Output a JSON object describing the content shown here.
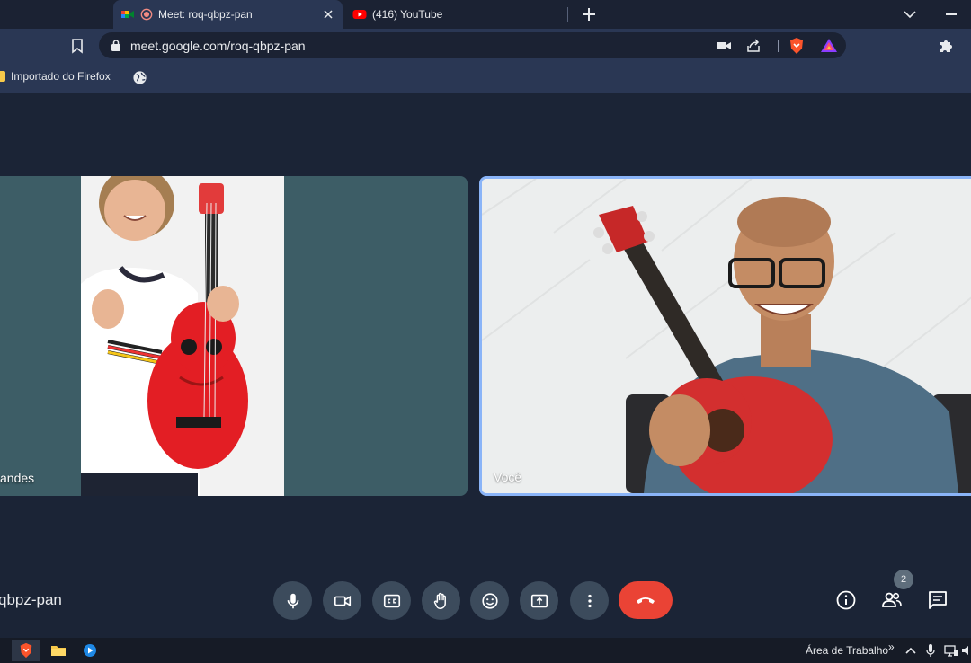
{
  "browser": {
    "tabs": [
      {
        "title": "Meet: roq-qbpz-pan",
        "active": true
      },
      {
        "title": "(416) YouTube",
        "active": false
      }
    ],
    "url": "meet.google.com/roq-qbpz-pan",
    "bookmarks": [
      {
        "label": "Importado do Firefox"
      }
    ]
  },
  "meet": {
    "participants": [
      {
        "name": "andes",
        "speaking": false
      },
      {
        "name": "Você",
        "speaking": true
      }
    ],
    "meeting_code": "qbpz-pan",
    "participant_count": "2",
    "controls": [
      "microphone",
      "camera",
      "captions",
      "raise-hand",
      "reactions",
      "present",
      "more-options",
      "leave-call"
    ],
    "side_controls": [
      "meeting-details",
      "people",
      "chat"
    ]
  },
  "taskbar": {
    "desktop_label": "Área de Trabalho",
    "overflow_label": "»"
  },
  "colors": {
    "tabstrip": "#1b2233",
    "toolbar": "#2a3754",
    "stage": "#1b2436",
    "tile": "#3d5d66",
    "active_border": "#8ab4f8",
    "hangup": "#ea4335",
    "control": "#3c4b5c"
  }
}
